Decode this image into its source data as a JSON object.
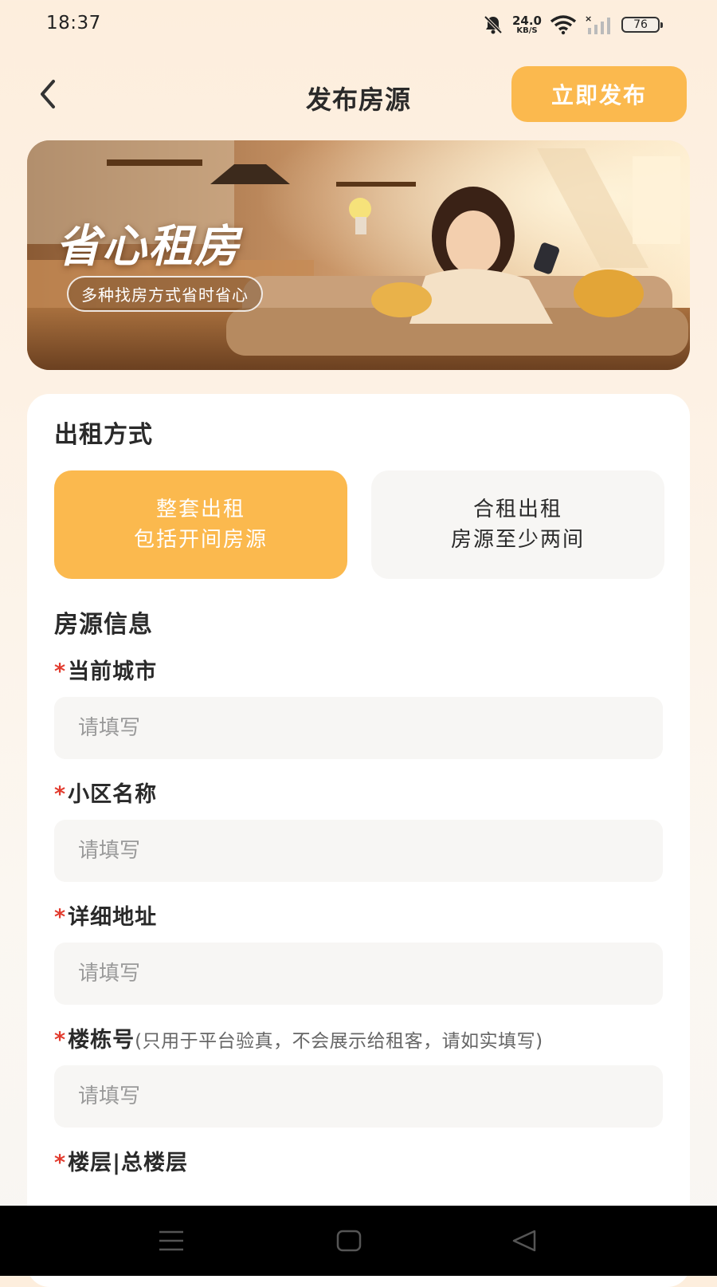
{
  "status_bar": {
    "time": "18:37",
    "net_speed": "24.0",
    "net_unit": "KB/S",
    "battery": "76",
    "icons": [
      "bell-muted-icon",
      "wifi-icon",
      "cellular-signal-icon",
      "battery-icon"
    ]
  },
  "header": {
    "title": "发布房源",
    "publish_label": "立即发布",
    "back_icon": "chevron-left-icon"
  },
  "banner": {
    "title": "省心租房",
    "subtitle": "多种找房方式省时省心"
  },
  "rent_type": {
    "section_title": "出租方式",
    "options": [
      {
        "line1": "整套出租",
        "line2": "包括开间房源",
        "selected": true
      },
      {
        "line1": "合租出租",
        "line2": "房源至少两间",
        "selected": false
      }
    ]
  },
  "listing_info": {
    "section_title": "房源信息",
    "required_mark": "*",
    "fields": [
      {
        "label": "当前城市",
        "hint": "",
        "placeholder": "请填写",
        "value": ""
      },
      {
        "label": "小区名称",
        "hint": "",
        "placeholder": "请填写",
        "value": ""
      },
      {
        "label": "详细地址",
        "hint": "",
        "placeholder": "请填写",
        "value": ""
      },
      {
        "label": "楼栋号",
        "hint": "(只用于平台验真，不会展示给租客，请如实填写)",
        "placeholder": "请填写",
        "value": ""
      },
      {
        "label": "楼层|总楼层",
        "hint": "",
        "placeholder": "",
        "value": ""
      }
    ]
  },
  "nav_bar": {
    "icons": [
      "menu-icon",
      "home-square-icon",
      "back-triangle-icon"
    ]
  },
  "colors": {
    "accent": "#fbb94e",
    "required": "#e23b2e",
    "input_bg": "#f7f6f4",
    "placeholder": "#9a9a9a"
  }
}
